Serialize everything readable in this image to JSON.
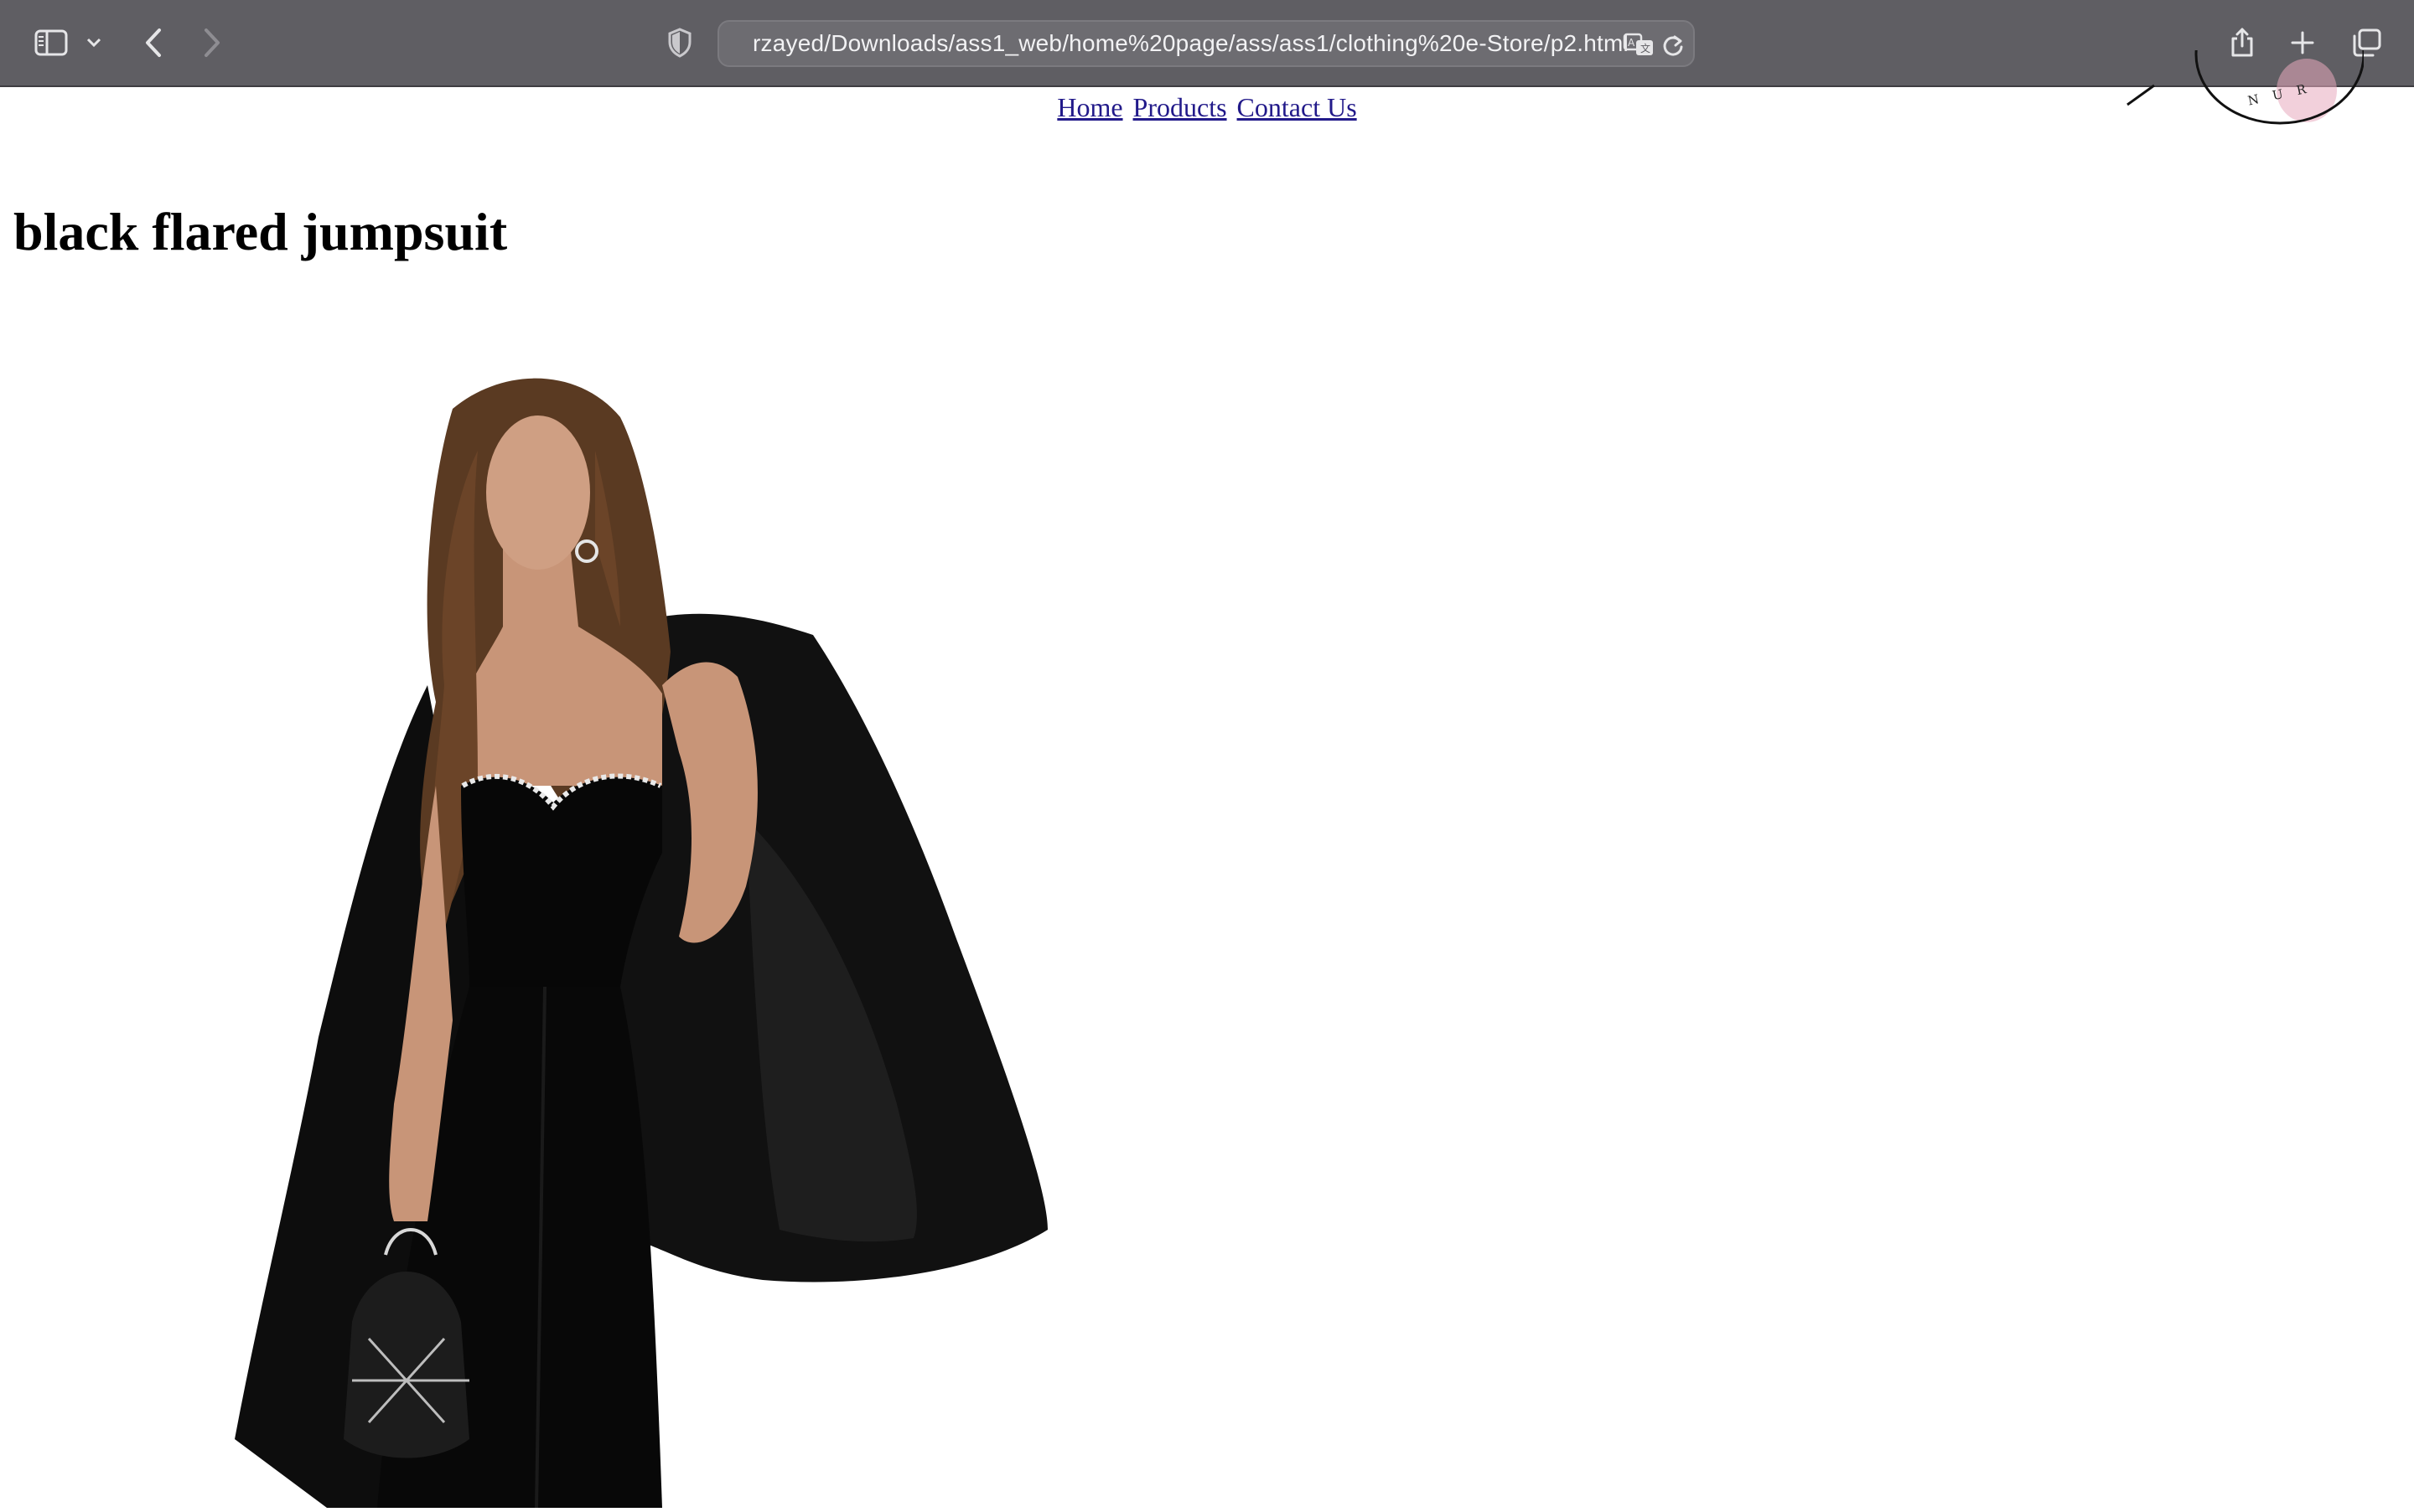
{
  "browser": {
    "url": "rzayed/Downloads/ass1_web/home%20page/ass/ass1/clothing%20e-Store/p2.html",
    "icons": [
      "sidebar-icon",
      "chevron-down-icon",
      "back-icon",
      "forward-icon",
      "privacy-shield-icon",
      "translate-icon",
      "reload-icon",
      "share-icon",
      "new-tab-icon",
      "tab-overview-icon"
    ]
  },
  "nav": {
    "links": [
      "Home",
      "Products",
      "Contact Us"
    ]
  },
  "product": {
    "title": "black flared jumpsuit"
  },
  "logo": {
    "partial_text": "N U R"
  },
  "colors": {
    "toolbar": "#5f5e63",
    "link": "#221a8a",
    "heading": "#000000",
    "logo_accent": "#e8a9bd"
  }
}
